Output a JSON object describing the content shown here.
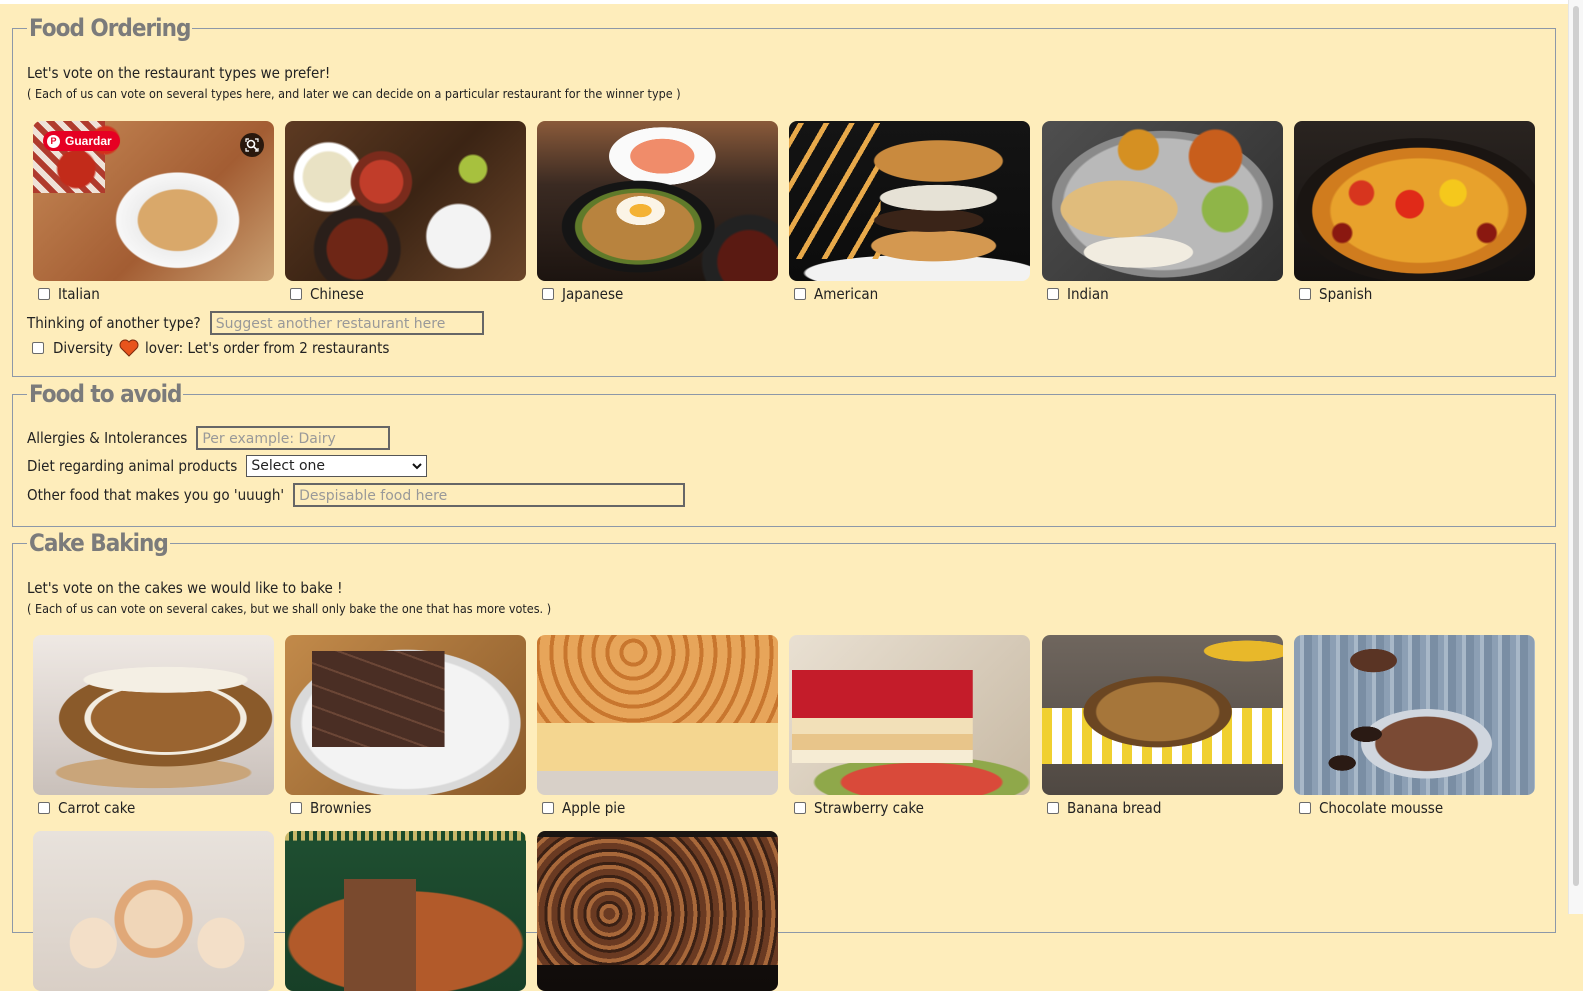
{
  "food_ordering": {
    "legend": "Food Ordering",
    "intro": "Let's vote on the restaurant types we prefer!",
    "note": "( Each of us can vote on several types here, and later we can decide on a particular restaurant for the winner type )",
    "options": [
      {
        "label": "Italian"
      },
      {
        "label": "Chinese"
      },
      {
        "label": "Japanese"
      },
      {
        "label": "American"
      },
      {
        "label": "Indian"
      },
      {
        "label": "Spanish"
      }
    ],
    "pin_badge": "Guardar",
    "another_type_label": "Thinking of another type?",
    "another_type_placeholder": "Suggest another restaurant here",
    "diversity_before": "Diversity",
    "diversity_after": "lover: Let's order from 2 restaurants"
  },
  "food_to_avoid": {
    "legend": "Food to avoid",
    "allergies_label": "Allergies & Intolerances",
    "allergies_placeholder": "Per example: Dairy",
    "diet_label": "Diet regarding animal products",
    "diet_selected": "Select one",
    "other_label": "Other food that makes you go 'uuugh'",
    "other_placeholder": "Despisable food here"
  },
  "cake_baking": {
    "legend": "Cake Baking",
    "intro": "Let's vote on the cakes we would like to bake !",
    "note": "( Each of us can vote on several cakes, but we shall only bake the one that has more votes. )",
    "options": [
      {
        "label": "Carrot cake"
      },
      {
        "label": "Brownies"
      },
      {
        "label": "Apple pie"
      },
      {
        "label": "Strawberry cake"
      },
      {
        "label": "Banana bread"
      },
      {
        "label": "Chocolate mousse"
      }
    ]
  },
  "colors": {
    "page_background": "#feedbb",
    "fieldset_border": "#8d98a8",
    "legend_text": "#7b7b7b",
    "heart": "#e8541c",
    "pinterest": "#e60023"
  }
}
